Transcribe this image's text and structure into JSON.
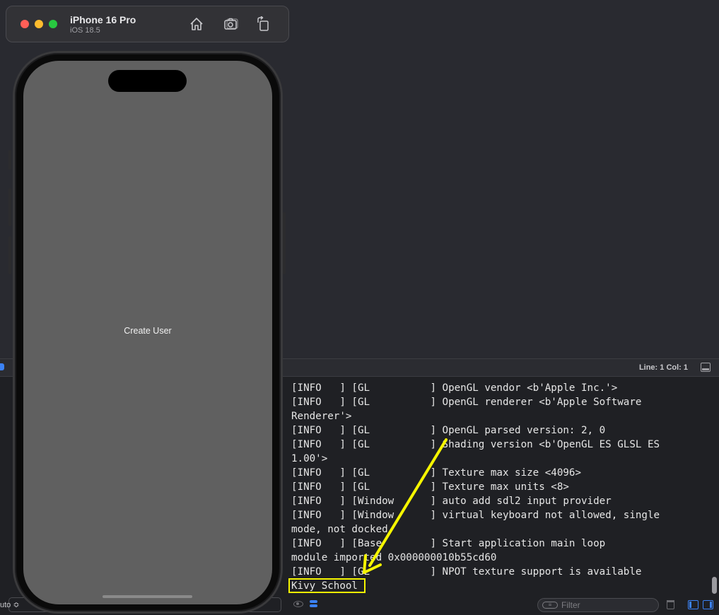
{
  "simulator": {
    "device_name": "iPhone 16 Pro",
    "os_version": "iOS 18.5",
    "toolbar_icons": [
      "home-icon",
      "screenshot-icon",
      "rotate-icon"
    ]
  },
  "app": {
    "button_label": "Create User"
  },
  "debug_bar": {
    "cursor_position": "Line: 1  Col: 1"
  },
  "console": {
    "lines": [
      "[INFO   ] [GL          ] OpenGL vendor <b'Apple Inc.'>",
      "[INFO   ] [GL          ] OpenGL renderer <b'Apple Software",
      "Renderer'>",
      "[INFO   ] [GL          ] OpenGL parsed version: 2, 0",
      "[INFO   ] [GL          ] Shading version <b'OpenGL ES GLSL ES",
      "1.00'>",
      "[INFO   ] [GL          ] Texture max size <4096>",
      "[INFO   ] [GL          ] Texture max units <8>",
      "[INFO   ] [Window      ] auto add sdl2 input provider",
      "[INFO   ] [Window      ] virtual keyboard not allowed, single",
      "mode, not docked",
      "[INFO   ] [Base        ] Start application main loop",
      "module imported 0x000000010b55cd60",
      "[INFO   ] [GL          ] NPOT texture support is available",
      "Kivy School"
    ],
    "highlighted_output": "Kivy School"
  },
  "console_footer": {
    "filter_placeholder": "Filter"
  },
  "left_panel": {
    "selector_label": "uto ≎"
  },
  "colors": {
    "annotation": "#f5f500",
    "accent": "#3b82f6"
  }
}
